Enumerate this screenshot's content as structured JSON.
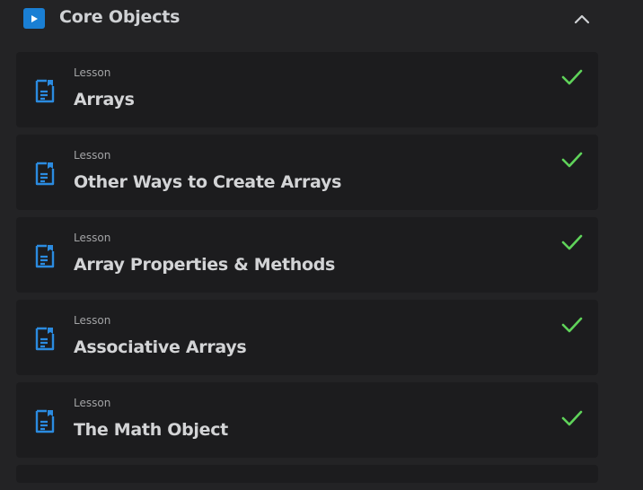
{
  "section": {
    "title": "Core Objects",
    "icon": "play-icon",
    "toggle_icon": "chevron-up-icon",
    "expanded": true,
    "accent_color": "#1a7fd4"
  },
  "lessons": [
    {
      "kicker": "Lesson",
      "title": "Arrays",
      "icon": "document-icon",
      "completed": true
    },
    {
      "kicker": "Lesson",
      "title": "Other Ways to Create Arrays",
      "icon": "document-icon",
      "completed": true
    },
    {
      "kicker": "Lesson",
      "title": "Array Properties & Methods",
      "icon": "document-icon",
      "completed": true
    },
    {
      "kicker": "Lesson",
      "title": "Associative Arrays",
      "icon": "document-icon",
      "completed": true
    },
    {
      "kicker": "Lesson",
      "title": "The Math Object",
      "icon": "document-icon",
      "completed": true
    }
  ],
  "colors": {
    "background": "#232325",
    "card": "#1c1c1e",
    "check": "#5fd35a",
    "doc_icon": "#2b8be0"
  }
}
